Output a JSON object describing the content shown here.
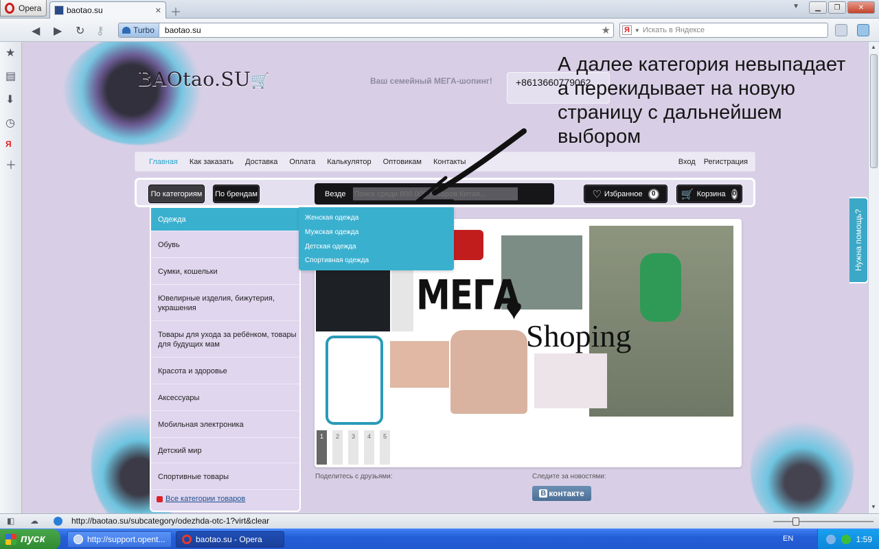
{
  "browser": {
    "menu_label": "Opera",
    "tab_title": "baotao.su",
    "turbo_label": "Turbo",
    "url": "baotao.su",
    "search_placeholder": "Искать в Яндексе",
    "status_url": "http://baotao.su/subcategory/odezhda-otc-1?virt&clear"
  },
  "site": {
    "logo": "BAOtao.SU",
    "slogan": "Ваш семейный МЕГА-шопинг!",
    "phone": "+8613660779062",
    "nav": [
      "Главная",
      "Как заказать",
      "Доставка",
      "Оплата",
      "Калькулятор",
      "Оптовикам",
      "Контакты"
    ],
    "nav_right": [
      "Вход",
      "Регистрация"
    ],
    "btn_categories": "По категориям",
    "btn_brands": "По брендам",
    "search_scope": "Везде",
    "search_placeholder": "Поиск среди 800 000 товаров Китая...",
    "favorites_label": "Избранное",
    "favorites_count": "0",
    "cart_label": "Корзина",
    "cart_count": "0",
    "categories": [
      "Одежда",
      "Обувь",
      "Сумки, кошельки",
      "Ювелирные изделия, бижутерия, украшения",
      "Товары для ухода за ребёнком, товары для будущих мам",
      "Красота и здоровье",
      "Аксессуары",
      "Мобильная электроника",
      "Детский мир",
      "Спортивные товары"
    ],
    "all_categories": "Все категории товаров",
    "submenu": [
      "Женская одежда",
      "Мужская одежда",
      "Детская одежда",
      "Спортивная одежда"
    ],
    "banner_pages": [
      "1",
      "2",
      "3",
      "4",
      "5"
    ],
    "share_label": "Поделитесь с друзьями:",
    "follow_label": "Следите за новостями:",
    "vk_label": "контакте",
    "help_tab": "Нужна помощь?"
  },
  "note": "А далее категория невыпадает а перекидывает на новую страницу с дальнейшем выбором",
  "taskbar": {
    "start": "пуск",
    "tasks": [
      "http://support.opent...",
      "baotao.su - Opera"
    ],
    "lang": "EN",
    "time": "1:59"
  },
  "colors": {
    "accent": "#3ab0cf",
    "page_bg": "#d8cfe6",
    "dark_button": "#161618"
  }
}
